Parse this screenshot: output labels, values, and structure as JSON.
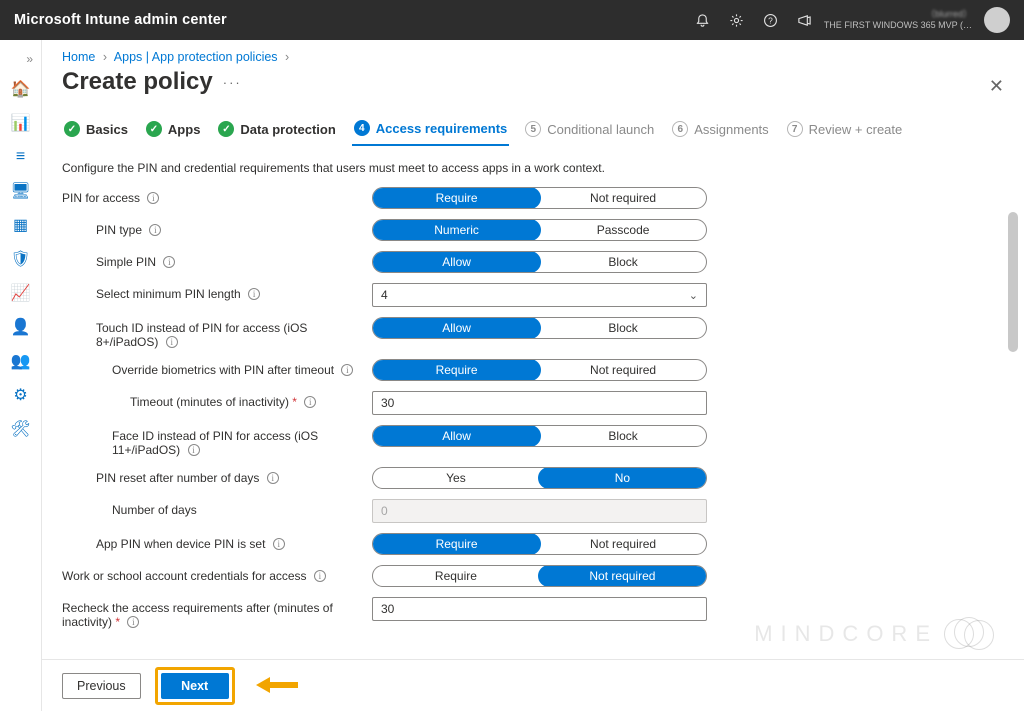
{
  "header": {
    "product": "Microsoft Intune admin center",
    "tenant_line1": "（blurred）",
    "tenant_line2": "THE FIRST WINDOWS 365 MVP (…"
  },
  "icons": {
    "bell": "🔔",
    "gear": "⚙",
    "help": "?",
    "feedback": "📣"
  },
  "rail": {
    "items": [
      {
        "name": "home",
        "glyph": "🏠"
      },
      {
        "name": "dashboard",
        "glyph": "📊"
      },
      {
        "name": "all-services",
        "glyph": "≡"
      },
      {
        "name": "devices",
        "glyph": "🖥"
      },
      {
        "name": "apps",
        "glyph": "▦"
      },
      {
        "name": "endpoint-security",
        "glyph": "🛡"
      },
      {
        "name": "reports",
        "glyph": "📈"
      },
      {
        "name": "users",
        "glyph": "👤"
      },
      {
        "name": "groups",
        "glyph": "👥"
      },
      {
        "name": "tenant-admin",
        "glyph": "⚙"
      },
      {
        "name": "troubleshoot",
        "glyph": "🛠"
      }
    ]
  },
  "breadcrumb": {
    "home": "Home",
    "apps": "Apps | App protection policies"
  },
  "title": "Create policy",
  "steps": [
    {
      "num": "",
      "label": "Basics",
      "state": "done"
    },
    {
      "num": "",
      "label": "Apps",
      "state": "done"
    },
    {
      "num": "",
      "label": "Data protection",
      "state": "done"
    },
    {
      "num": "4",
      "label": "Access requirements",
      "state": "active"
    },
    {
      "num": "5",
      "label": "Conditional launch",
      "state": "future"
    },
    {
      "num": "6",
      "label": "Assignments",
      "state": "future"
    },
    {
      "num": "7",
      "label": "Review + create",
      "state": "future"
    }
  ],
  "help": "Configure the PIN and credential requirements that users must meet to access apps in a work context.",
  "fields": {
    "pin_for_access": {
      "label": "PIN for access",
      "opts": [
        "Require",
        "Not required"
      ],
      "sel": 0,
      "indent": 0
    },
    "pin_type": {
      "label": "PIN type",
      "opts": [
        "Numeric",
        "Passcode"
      ],
      "sel": 0,
      "indent": 1
    },
    "simple_pin": {
      "label": "Simple PIN",
      "opts": [
        "Allow",
        "Block"
      ],
      "sel": 0,
      "indent": 1
    },
    "min_len": {
      "label": "Select minimum PIN length",
      "value": "4",
      "indent": 1,
      "type": "select"
    },
    "touch_id": {
      "label": "Touch ID instead of PIN for access (iOS 8+/iPadOS)",
      "opts": [
        "Allow",
        "Block"
      ],
      "sel": 0,
      "indent": 1
    },
    "override_bio": {
      "label": "Override biometrics with PIN after timeout",
      "opts": [
        "Require",
        "Not required"
      ],
      "sel": 0,
      "indent": 2
    },
    "timeout": {
      "label": "Timeout (minutes of inactivity)",
      "req": true,
      "value": "30",
      "indent": 3,
      "type": "text"
    },
    "face_id": {
      "label": "Face ID instead of PIN for access (iOS 11+/iPadOS)",
      "opts": [
        "Allow",
        "Block"
      ],
      "sel": 0,
      "indent": 2
    },
    "pin_reset": {
      "label": "PIN reset after number of days",
      "opts": [
        "Yes",
        "No"
      ],
      "sel": 1,
      "indent": 1
    },
    "num_days": {
      "label": "Number of days",
      "value": "0",
      "indent": 2,
      "type": "text",
      "disabled": true
    },
    "app_pin": {
      "label": "App PIN when device PIN is set",
      "opts": [
        "Require",
        "Not required"
      ],
      "sel": 0,
      "indent": 1
    },
    "work_account": {
      "label": "Work or school account credentials for access",
      "opts": [
        "Require",
        "Not required"
      ],
      "sel": 1,
      "indent": 0
    },
    "recheck": {
      "label": "Recheck the access requirements after (minutes of inactivity)",
      "req": true,
      "value": "30",
      "indent": 0,
      "type": "text"
    }
  },
  "buttons": {
    "previous": "Previous",
    "next": "Next"
  },
  "watermark": "MINDCORE"
}
